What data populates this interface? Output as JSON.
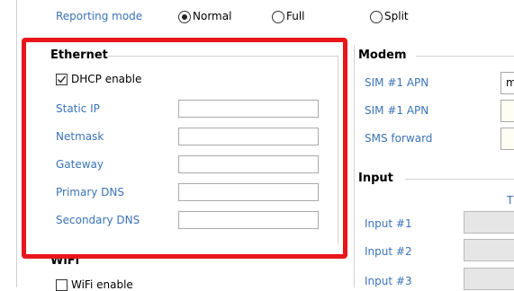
{
  "reporting": {
    "label": "Reporting mode",
    "options": [
      "Normal",
      "Full",
      "Split"
    ],
    "selected": "Normal"
  },
  "ethernet": {
    "title": "Ethernet",
    "dhcp_label": "DHCP enable",
    "dhcp_checked": true,
    "fields": [
      {
        "label": "Static IP",
        "value": ""
      },
      {
        "label": "Netmask",
        "value": ""
      },
      {
        "label": "Gateway",
        "value": ""
      },
      {
        "label": "Primary DNS",
        "value": ""
      },
      {
        "label": "Secondary DNS",
        "value": ""
      }
    ]
  },
  "wifi": {
    "title": "WiFi",
    "enable_label": "WiFi enable",
    "enable_checked": false
  },
  "modem": {
    "title": "Modem",
    "fields": [
      {
        "label": "SIM #1 APN",
        "value": "m"
      },
      {
        "label": "SIM #1 APN",
        "value": ""
      },
      {
        "label": "SMS forward",
        "value": ""
      }
    ]
  },
  "input": {
    "title": "Input",
    "column_header": "T",
    "rows": [
      {
        "label": "Input #1"
      },
      {
        "label": "Input #2"
      },
      {
        "label": "Input #3"
      }
    ]
  },
  "annotation": {
    "color": "#e8151b"
  }
}
